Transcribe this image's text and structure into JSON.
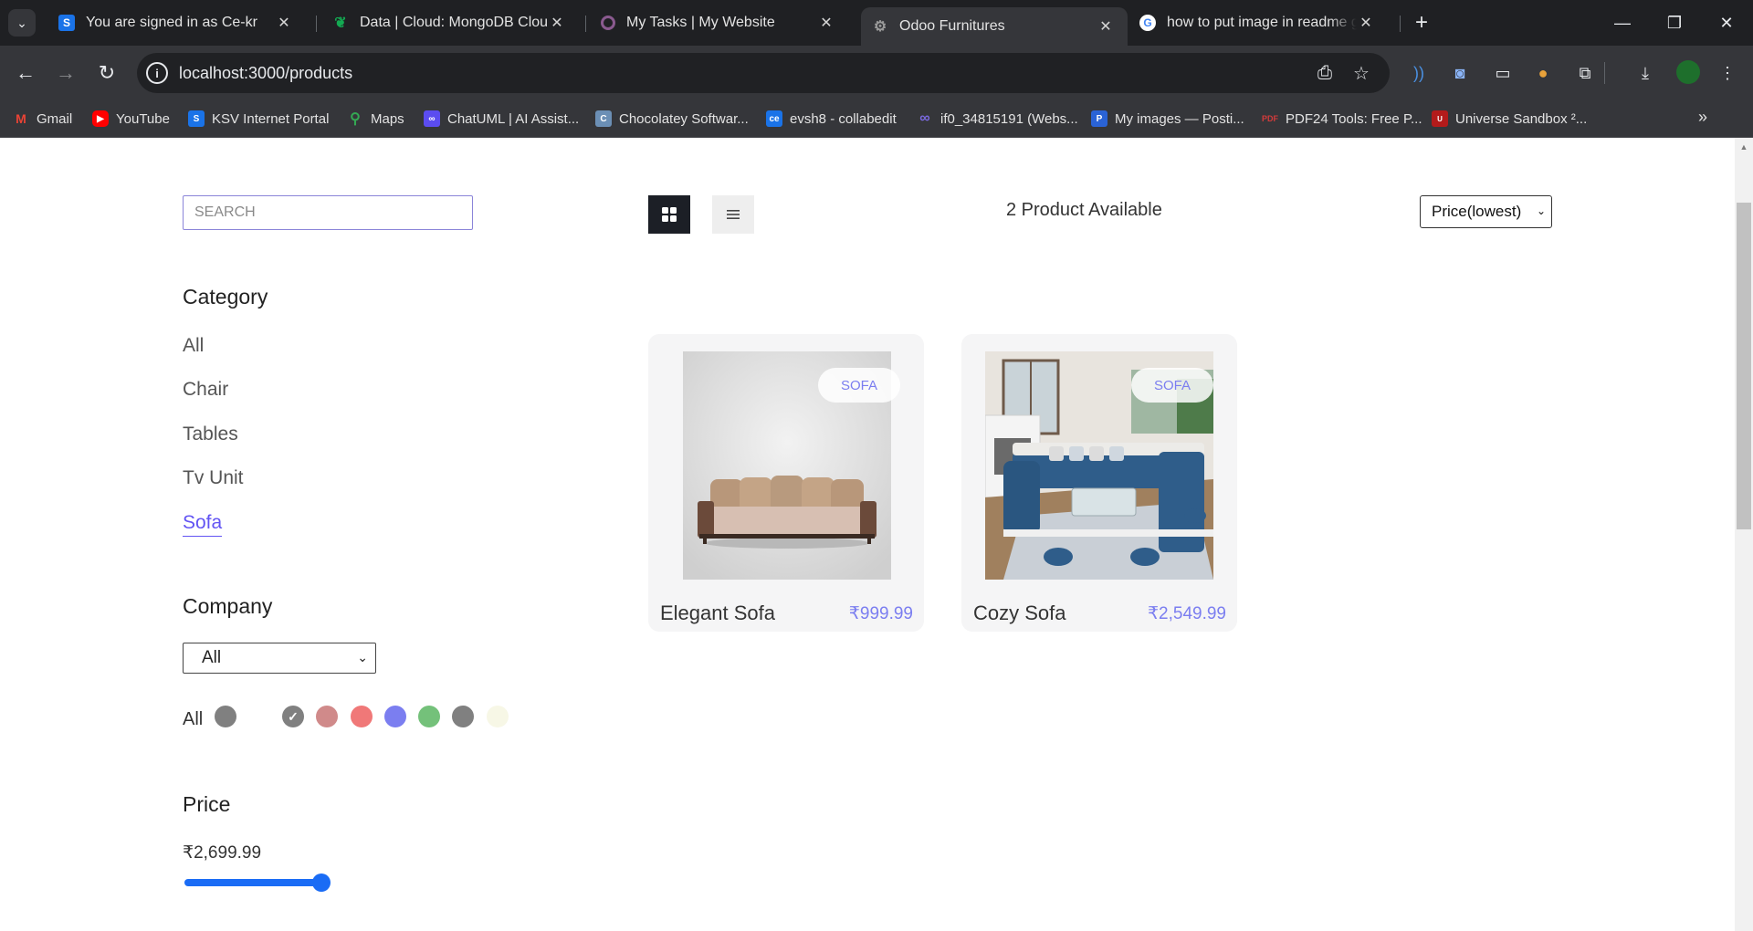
{
  "browser": {
    "tabs": [
      {
        "title": "You are signed in as Ce-kr",
        "icon": "s-icon",
        "color": "#1a73e8",
        "glyph": "S"
      },
      {
        "title": "Data | Cloud: MongoDB Cloud",
        "icon": "mongodb-leaf-icon",
        "color": "#13aa52",
        "glyph": "▮"
      },
      {
        "title": "My Tasks | My Website",
        "icon": "ring-icon",
        "color": "#6a3d6e",
        "glyph": "○"
      },
      {
        "title": "Odoo Furnitures",
        "icon": "react-icon",
        "color": "#5a5a5a",
        "glyph": "⚛"
      },
      {
        "title": "how to put image in readme gi",
        "icon": "google-icon",
        "color": "#ffffff",
        "glyph": "G"
      }
    ],
    "url": "localhost:3000/products",
    "bookmarks": [
      {
        "label": "Gmail",
        "icon": "gmail-icon",
        "color": "#ea4335",
        "glyph": "M"
      },
      {
        "label": "YouTube",
        "icon": "youtube-icon",
        "color": "#ff0000",
        "glyph": "▶"
      },
      {
        "label": "KSV Internet Portal",
        "icon": "ksv-icon",
        "color": "#1a73e8",
        "glyph": "S"
      },
      {
        "label": "Maps",
        "icon": "maps-icon",
        "color": "#34a853",
        "glyph": "◆"
      },
      {
        "label": "ChatUML | AI Assist...",
        "icon": "chatuml-icon",
        "color": "#5b4cf0",
        "glyph": "∞"
      },
      {
        "label": "Chocolatey Softwar...",
        "icon": "chocolatey-icon",
        "color": "#6b8fb5",
        "glyph": "C"
      },
      {
        "label": "evsh8 - collabedit",
        "icon": "collabedit-icon",
        "color": "#1a73e8",
        "glyph": "ce"
      },
      {
        "label": "if0_34815191 (Webs...",
        "icon": "infinity-icon",
        "color": "#6a5acd",
        "glyph": "∞"
      },
      {
        "label": "My images — Posti...",
        "icon": "postimages-icon",
        "color": "#2a63d6",
        "glyph": "P"
      },
      {
        "label": "PDF24 Tools: Free P...",
        "icon": "pdf24-icon",
        "color": "#d33b3b",
        "glyph": "P"
      },
      {
        "label": "Universe Sandbox ²...",
        "icon": "sandbox-icon",
        "color": "#b31b1b",
        "glyph": "U"
      }
    ]
  },
  "filters": {
    "search_placeholder": "SEARCH",
    "category_heading": "Category",
    "categories": [
      "All",
      "Chair",
      "Tables",
      "Tv Unit",
      "Sofa"
    ],
    "active_category": "Sofa",
    "company_heading": "Company",
    "company_selected": "All",
    "colors_label": "All",
    "colors": [
      "#808080",
      "#808080",
      "#d08a8a",
      "#f07878",
      "#7b7ef0",
      "#74c17a",
      "#808080",
      "#f7f7e6"
    ],
    "selected_color_index": 1,
    "price_heading": "Price",
    "price_value": "₹2,699.99",
    "price_fraction": 1.0
  },
  "listing": {
    "count_text": "2 Product Available",
    "sort_selected": "Price(lowest)",
    "view_mode": "grid"
  },
  "products": [
    {
      "name": "Elegant Sofa",
      "price": "₹999.99",
      "tag": "SOFA"
    },
    {
      "name": "Cozy Sofa",
      "price": "₹2,549.99",
      "tag": "SOFA"
    }
  ]
}
